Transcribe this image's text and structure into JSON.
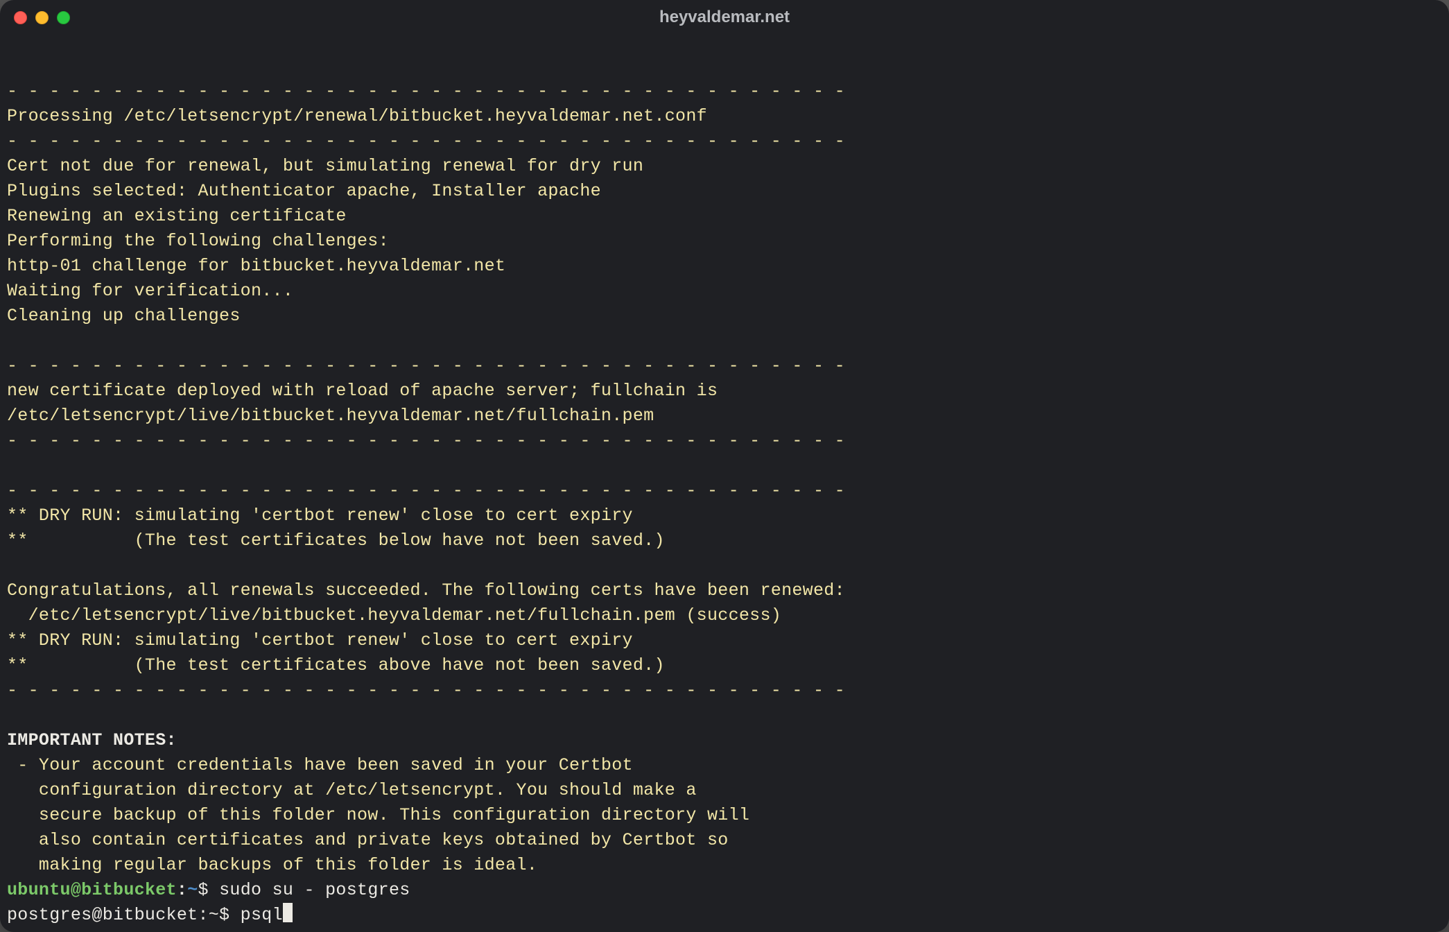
{
  "window": {
    "title": "heyvaldemar.net"
  },
  "output": {
    "sep": "- - - - - - - - - - - - - - - - - - - - - - - - - - - - - - - - - - - - - - - -",
    "l01": "Processing /etc/letsencrypt/renewal/bitbucket.heyvaldemar.net.conf",
    "l02": "Cert not due for renewal, but simulating renewal for dry run",
    "l03": "Plugins selected: Authenticator apache, Installer apache",
    "l04": "Renewing an existing certificate",
    "l05": "Performing the following challenges:",
    "l06": "http-01 challenge for bitbucket.heyvaldemar.net",
    "l07": "Waiting for verification...",
    "l08": "Cleaning up challenges",
    "l09": "new certificate deployed with reload of apache server; fullchain is",
    "l10": "/etc/letsencrypt/live/bitbucket.heyvaldemar.net/fullchain.pem",
    "l11": "** DRY RUN: simulating 'certbot renew' close to cert expiry",
    "l12": "**          (The test certificates below have not been saved.)",
    "l13": "Congratulations, all renewals succeeded. The following certs have been renewed:",
    "l14": "  /etc/letsencrypt/live/bitbucket.heyvaldemar.net/fullchain.pem (success)",
    "l15": "** DRY RUN: simulating 'certbot renew' close to cert expiry",
    "l16": "**          (The test certificates above have not been saved.)",
    "note_h": "IMPORTANT NOTES:",
    "note1": " - Your account credentials have been saved in your Certbot",
    "note2": "   configuration directory at /etc/letsencrypt. You should make a",
    "note3": "   secure backup of this folder now. This configuration directory will",
    "note4": "   also contain certificates and private keys obtained by Certbot so",
    "note5": "   making regular backups of this folder is ideal."
  },
  "prompts": {
    "p1": {
      "user": "ubuntu",
      "at": "@",
      "host": "bitbucket",
      "colon": ":",
      "path": "~",
      "dollar": "$ ",
      "cmd": "sudo su - postgres"
    },
    "p2": {
      "line_prefix": "postgres@bitbucket:~$ ",
      "cmd": "psql"
    }
  }
}
